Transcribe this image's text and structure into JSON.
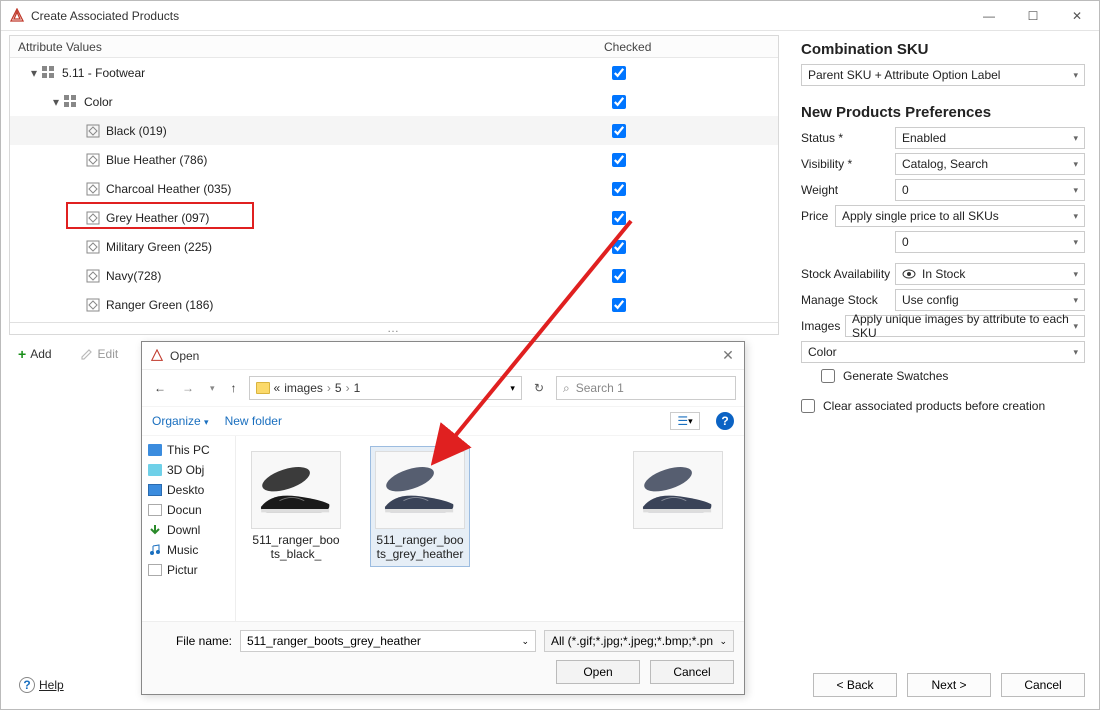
{
  "window": {
    "title": "Create Associated Products"
  },
  "tree": {
    "header_attr": "Attribute Values",
    "header_checked": "Checked",
    "rows": [
      {
        "label": "5.11 - Footwear",
        "depth": 0,
        "expander": "▾",
        "icon": "grid",
        "checked": true
      },
      {
        "label": "Color",
        "depth": 1,
        "expander": "▾",
        "icon": "grid",
        "checked": true
      },
      {
        "label": "Black (019)",
        "depth": 2,
        "expander": "",
        "icon": "swatch",
        "checked": true,
        "hl": true
      },
      {
        "label": "Blue Heather (786)",
        "depth": 2,
        "expander": "",
        "icon": "swatch",
        "checked": true
      },
      {
        "label": "Charcoal Heather (035)",
        "depth": 2,
        "expander": "",
        "icon": "swatch",
        "checked": true
      },
      {
        "label": "Grey Heather (097)",
        "depth": 2,
        "expander": "",
        "icon": "swatch",
        "checked": true,
        "highlight": true
      },
      {
        "label": "Military Green (225)",
        "depth": 2,
        "expander": "",
        "icon": "swatch",
        "checked": true
      },
      {
        "label": "Navy(728)",
        "depth": 2,
        "expander": "",
        "icon": "swatch",
        "checked": true
      },
      {
        "label": "Ranger Green (186)",
        "depth": 2,
        "expander": "",
        "icon": "swatch",
        "checked": true
      }
    ]
  },
  "toolbar": {
    "add": "Add",
    "edit": "Edit"
  },
  "file_dialog": {
    "title": "Open",
    "path_prefix": "«",
    "crumbs": [
      "images",
      "5",
      "1"
    ],
    "search_placeholder": "Search 1",
    "organize": "Organize",
    "new_folder": "New folder",
    "side": [
      "This PC",
      "3D Obj",
      "Deskto",
      "Docun",
      "Downl",
      "Music",
      "Pictur"
    ],
    "files": [
      {
        "name": "511_ranger_boots_black_",
        "color": "#1a1a1a",
        "selected": false
      },
      {
        "name": "511_ranger_boots_grey_heather",
        "color": "#3a4358",
        "selected": true
      },
      {
        "name": "",
        "color": "#3a4358",
        "selected": false
      }
    ],
    "file_name_label": "File name:",
    "file_name_value": "511_ranger_boots_grey_heather",
    "filter": "All (*.gif;*.jpg;*.jpeg;*.bmp;*.pn",
    "open_btn": "Open",
    "cancel_btn": "Cancel"
  },
  "right": {
    "combo_sku_title": "Combination SKU",
    "combo_sku_value": "Parent SKU + Attribute Option Label",
    "prefs_title": "New Products Preferences",
    "status_label": "Status *",
    "status_value": "Enabled",
    "visibility_label": "Visibility *",
    "visibility_value": "Catalog, Search",
    "weight_label": "Weight",
    "weight_value": "0",
    "price_label": "Price",
    "price_mode": "Apply single price to all SKUs",
    "price_value": "0",
    "stock_avail_label": "Stock Availability",
    "stock_avail_value": "In Stock",
    "manage_stock_label": "Manage Stock",
    "manage_stock_value": "Use config",
    "images_label": "Images",
    "images_mode": "Apply unique images by attribute to each SKU",
    "images_attr": "Color",
    "gen_swatches": "Generate Swatches",
    "clear_assoc": "Clear associated products before creation"
  },
  "footer": {
    "help": "Help",
    "back": "< Back",
    "next": "Next >",
    "cancel": "Cancel"
  }
}
